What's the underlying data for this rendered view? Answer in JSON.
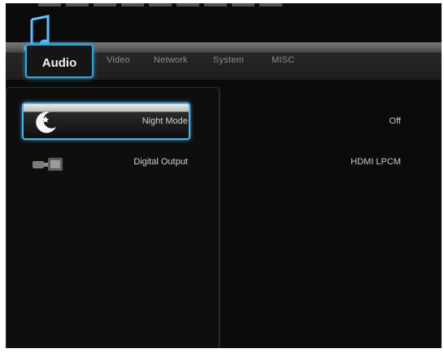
{
  "tabs": [
    {
      "label": "Audio",
      "active": true
    },
    {
      "label": "Video",
      "active": false
    },
    {
      "label": "Network",
      "active": false
    },
    {
      "label": "System",
      "active": false
    },
    {
      "label": "MISC",
      "active": false
    }
  ],
  "settings": [
    {
      "label": "Night Mode",
      "value": "Off",
      "icon": "moon-icon",
      "selected": true
    },
    {
      "label": "Digital Output",
      "value": "HDMI LPCM",
      "icon": "digital-output-icon",
      "selected": false
    }
  ],
  "colors": {
    "accent": "#37a4d8",
    "background": "#0b0b0b"
  }
}
